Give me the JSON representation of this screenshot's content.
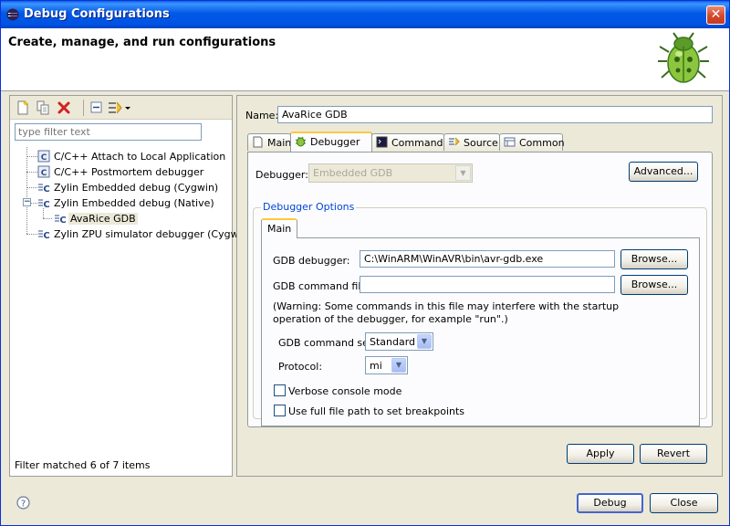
{
  "window": {
    "title": "Debug Configurations"
  },
  "header": {
    "title": "Create, manage, and run configurations"
  },
  "left": {
    "filter_placeholder": "type filter text",
    "tree": [
      {
        "label": "C/C++ Attach to Local Application",
        "icon": "c-config-icon"
      },
      {
        "label": "C/C++ Postmortem debugger",
        "icon": "c-config-icon"
      },
      {
        "label": "Zylin Embedded debug (Cygwin)",
        "icon": "zylin-icon"
      },
      {
        "label": "Zylin Embedded debug (Native)",
        "icon": "zylin-icon",
        "expanded": true
      },
      {
        "label": "AvaRice GDB",
        "icon": "zylin-icon",
        "selected": true
      },
      {
        "label": "Zylin ZPU simulator debugger (Cygwin)",
        "icon": "zylin-icon"
      }
    ],
    "status": "Filter matched 6 of 7 items"
  },
  "right": {
    "name_label": "Name:",
    "name_value": "AvaRice GDB",
    "tabs": [
      {
        "label": "Main",
        "icon": "main-tab-icon"
      },
      {
        "label": "Debugger",
        "icon": "bug-icon",
        "active": true
      },
      {
        "label": "Commands",
        "icon": "console-icon"
      },
      {
        "label": "Source",
        "icon": "source-icon"
      },
      {
        "label": "Common",
        "icon": "common-icon"
      }
    ],
    "debugger_label": "Debugger:",
    "debugger_value": "Embedded GDB",
    "advanced_label": "Advanced...",
    "options_title": "Debugger Options",
    "inner_tab": "Main",
    "gdb_debugger_label": "GDB debugger:",
    "gdb_debugger_value": "C:\\WinARM\\WinAVR\\bin\\avr-gdb.exe",
    "browse_label": "Browse...",
    "gdb_cmdfile_label": "GDB command file:",
    "gdb_cmdfile_value": "",
    "warning": "(Warning: Some commands in this file may interfere with the startup operation of the debugger, for example \"run\".)",
    "cmdset_label": "GDB command set:",
    "cmdset_value": "Standard",
    "protocol_label": "Protocol:",
    "protocol_value": "mi",
    "verbose_label": "Verbose console mode",
    "fullpath_label": "Use full file path to set breakpoints",
    "apply_label": "Apply",
    "revert_label": "Revert"
  },
  "footer": {
    "debug_label": "Debug",
    "close_label": "Close"
  }
}
